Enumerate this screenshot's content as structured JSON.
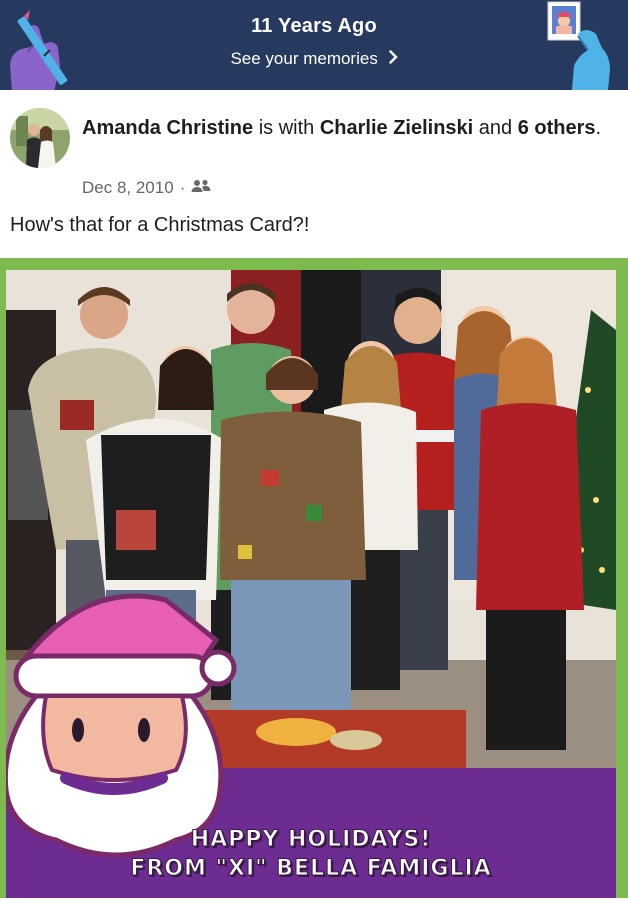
{
  "banner": {
    "title": "11 Years Ago",
    "link_label": "See your memories",
    "chevron_icon": "chevron-right-icon",
    "background": "#253a5e"
  },
  "post": {
    "author": "Amanda Christine",
    "with_text": " is with ",
    "tagged": "Charlie Zielinski",
    "and_text": " and ",
    "others": "6 others",
    "end_punct": ".",
    "date": "Dec 8, 2010",
    "separator": "·",
    "audience_icon": "friends-icon",
    "caption": "How's that for a Christmas Card?!"
  },
  "photo": {
    "frame_color": "#7dbb4e",
    "banner_color": "#6c2c91",
    "text_line1": "HAPPY HOLIDAYS!",
    "text_line2": "FROM \"XI\" BELLA FAMIGLIA"
  }
}
